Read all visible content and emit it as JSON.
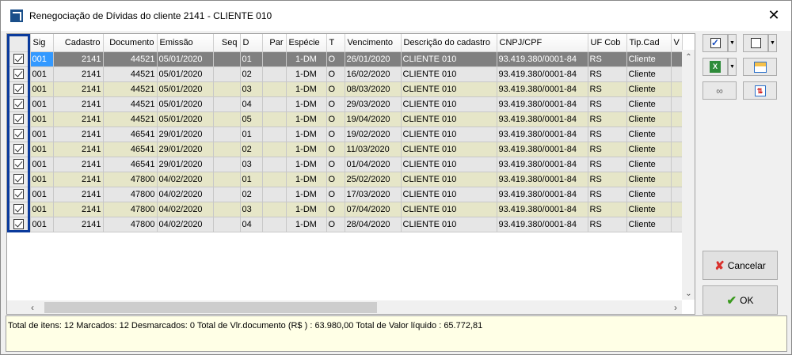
{
  "window": {
    "title": "Renegociação de Dívidas do cliente 2141 - CLIENTE 010",
    "close": "✕"
  },
  "grid": {
    "columns": [
      "",
      "Sig",
      "Cadastro",
      "Documento",
      "Emissão",
      "Seq",
      "D",
      "Par",
      "Espécie",
      "T",
      "Vencimento",
      "Descrição do cadastro",
      "CNPJ/CPF",
      "UF Cob",
      "Tip.Cad",
      "V"
    ],
    "rows": [
      {
        "checked": true,
        "sig": "001",
        "cadastro": "2141",
        "documento": "44521",
        "emissao": "05/01/2020",
        "seq": "",
        "d": "01",
        "par": "",
        "especie": "1-DM",
        "t": "O",
        "vencimento": "26/01/2020",
        "descricao": "CLIENTE 010",
        "cnpj": "93.419.380/0001-84",
        "uf": "RS",
        "tipcad": "Cliente"
      },
      {
        "checked": true,
        "sig": "001",
        "cadastro": "2141",
        "documento": "44521",
        "emissao": "05/01/2020",
        "seq": "",
        "d": "02",
        "par": "",
        "especie": "1-DM",
        "t": "O",
        "vencimento": "16/02/2020",
        "descricao": "CLIENTE 010",
        "cnpj": "93.419.380/0001-84",
        "uf": "RS",
        "tipcad": "Cliente"
      },
      {
        "checked": true,
        "sig": "001",
        "cadastro": "2141",
        "documento": "44521",
        "emissao": "05/01/2020",
        "seq": "",
        "d": "03",
        "par": "",
        "especie": "1-DM",
        "t": "O",
        "vencimento": "08/03/2020",
        "descricao": "CLIENTE 010",
        "cnpj": "93.419.380/0001-84",
        "uf": "RS",
        "tipcad": "Cliente"
      },
      {
        "checked": true,
        "sig": "001",
        "cadastro": "2141",
        "documento": "44521",
        "emissao": "05/01/2020",
        "seq": "",
        "d": "04",
        "par": "",
        "especie": "1-DM",
        "t": "O",
        "vencimento": "29/03/2020",
        "descricao": "CLIENTE 010",
        "cnpj": "93.419.380/0001-84",
        "uf": "RS",
        "tipcad": "Cliente"
      },
      {
        "checked": true,
        "sig": "001",
        "cadastro": "2141",
        "documento": "44521",
        "emissao": "05/01/2020",
        "seq": "",
        "d": "05",
        "par": "",
        "especie": "1-DM",
        "t": "O",
        "vencimento": "19/04/2020",
        "descricao": "CLIENTE 010",
        "cnpj": "93.419.380/0001-84",
        "uf": "RS",
        "tipcad": "Cliente"
      },
      {
        "checked": true,
        "sig": "001",
        "cadastro": "2141",
        "documento": "46541",
        "emissao": "29/01/2020",
        "seq": "",
        "d": "01",
        "par": "",
        "especie": "1-DM",
        "t": "O",
        "vencimento": "19/02/2020",
        "descricao": "CLIENTE 010",
        "cnpj": "93.419.380/0001-84",
        "uf": "RS",
        "tipcad": "Cliente"
      },
      {
        "checked": true,
        "sig": "001",
        "cadastro": "2141",
        "documento": "46541",
        "emissao": "29/01/2020",
        "seq": "",
        "d": "02",
        "par": "",
        "especie": "1-DM",
        "t": "O",
        "vencimento": "11/03/2020",
        "descricao": "CLIENTE 010",
        "cnpj": "93.419.380/0001-84",
        "uf": "RS",
        "tipcad": "Cliente"
      },
      {
        "checked": true,
        "sig": "001",
        "cadastro": "2141",
        "documento": "46541",
        "emissao": "29/01/2020",
        "seq": "",
        "d": "03",
        "par": "",
        "especie": "1-DM",
        "t": "O",
        "vencimento": "01/04/2020",
        "descricao": "CLIENTE 010",
        "cnpj": "93.419.380/0001-84",
        "uf": "RS",
        "tipcad": "Cliente"
      },
      {
        "checked": true,
        "sig": "001",
        "cadastro": "2141",
        "documento": "47800",
        "emissao": "04/02/2020",
        "seq": "",
        "d": "01",
        "par": "",
        "especie": "1-DM",
        "t": "O",
        "vencimento": "25/02/2020",
        "descricao": "CLIENTE 010",
        "cnpj": "93.419.380/0001-84",
        "uf": "RS",
        "tipcad": "Cliente"
      },
      {
        "checked": true,
        "sig": "001",
        "cadastro": "2141",
        "documento": "47800",
        "emissao": "04/02/2020",
        "seq": "",
        "d": "02",
        "par": "",
        "especie": "1-DM",
        "t": "O",
        "vencimento": "17/03/2020",
        "descricao": "CLIENTE 010",
        "cnpj": "93.419.380/0001-84",
        "uf": "RS",
        "tipcad": "Cliente"
      },
      {
        "checked": true,
        "sig": "001",
        "cadastro": "2141",
        "documento": "47800",
        "emissao": "04/02/2020",
        "seq": "",
        "d": "03",
        "par": "",
        "especie": "1-DM",
        "t": "O",
        "vencimento": "07/04/2020",
        "descricao": "CLIENTE 010",
        "cnpj": "93.419.380/0001-84",
        "uf": "RS",
        "tipcad": "Cliente"
      },
      {
        "checked": true,
        "sig": "001",
        "cadastro": "2141",
        "documento": "47800",
        "emissao": "04/02/2020",
        "seq": "",
        "d": "04",
        "par": "",
        "especie": "1-DM",
        "t": "O",
        "vencimento": "28/04/2020",
        "descricao": "CLIENTE 010",
        "cnpj": "93.419.380/0001-84",
        "uf": "RS",
        "tipcad": "Cliente"
      }
    ]
  },
  "buttons": {
    "cancel": "Cancelar",
    "ok": "OK"
  },
  "status": "Total de itens: 12 Marcados: 12 Desmarcados: 0 Total de Vlr.documento (R$ ) : 63.980,00 Total de Valor líquido : 65.772,81",
  "colors": {
    "selection": "#808080",
    "current_cell": "#3399ff",
    "row_alt": "#e6e6c8",
    "row": "#e6e6e6",
    "frame": "#0a3a9c"
  }
}
